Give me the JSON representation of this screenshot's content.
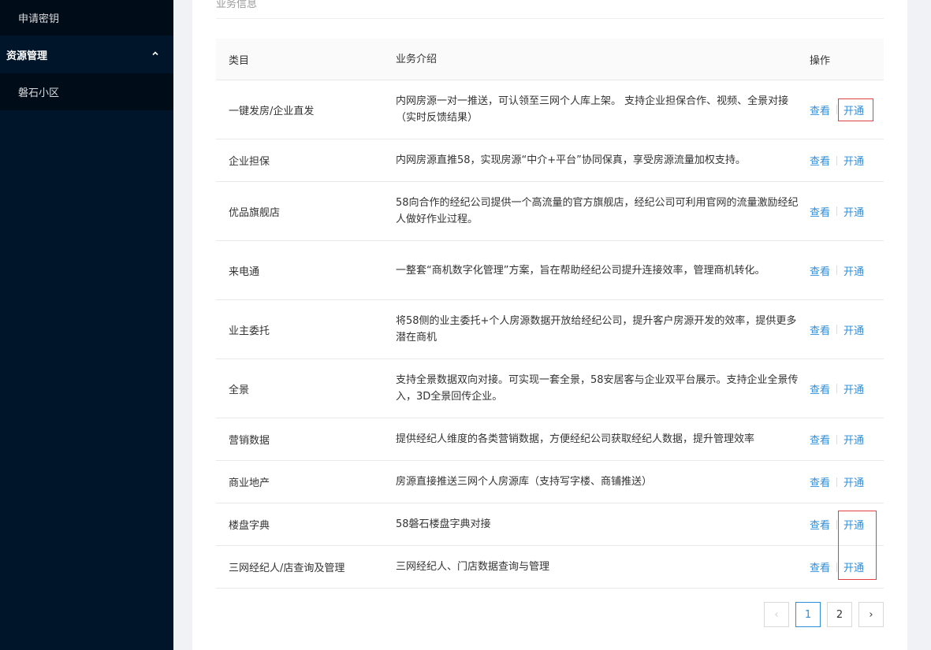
{
  "sidebar": {
    "top_item": "申请密钥",
    "group": "资源管理",
    "sub_item": "磐石小区"
  },
  "section": {
    "title": "业务信息"
  },
  "table": {
    "headers": [
      "类目",
      "业务介绍",
      "操作"
    ],
    "rows": [
      {
        "name": "一键发房/企业直发",
        "desc": "内网房源一对一推送，可认领至三网个人库上架。 支持企业担保合作、视频、全景对接（实时反馈结果）",
        "view": "查看",
        "open": "开通"
      },
      {
        "name": "企业担保",
        "desc": "内网房源直推58，实现房源“中介+平台”协同保真，享受房源流量加权支持。",
        "view": "查看",
        "open": "开通"
      },
      {
        "name": "优品旗舰店",
        "desc": "58向合作的经纪公司提供一个高流量的官方旗舰店，经纪公司可利用官网的流量激励经纪人做好作业过程。",
        "view": "查看",
        "open": "开通"
      },
      {
        "name": "来电通",
        "desc": "一整套“商机数字化管理”方案，旨在帮助经纪公司提升连接效率，管理商机转化。",
        "view": "查看",
        "open": "开通"
      },
      {
        "name": "业主委托",
        "desc": "将58侧的业主委托+个人房源数据开放给经纪公司，提升客户房源开发的效率，提供更多潜在商机",
        "view": "查看",
        "open": "开通"
      },
      {
        "name": "全景",
        "desc": "支持全景数据双向对接。可实现一套全景，58安居客与企业双平台展示。支持企业全景传入，3D全景回传企业。",
        "view": "查看",
        "open": "开通"
      },
      {
        "name": "营销数据",
        "desc": "提供经纪人维度的各类营销数据，方便经纪公司获取经纪人数据，提升管理效率",
        "view": "查看",
        "open": "开通"
      },
      {
        "name": "商业地产",
        "desc": "房源直接推送三网个人房源库（支持写字楼、商铺推送）",
        "view": "查看",
        "open": "开通"
      },
      {
        "name": "楼盘字典",
        "desc": "58磐石楼盘字典对接",
        "view": "查看",
        "open": "开通"
      },
      {
        "name": "三网经纪人/店查询及管理",
        "desc": "三网经纪人、门店数据查询与管理",
        "view": "查看",
        "open": "开通"
      }
    ]
  },
  "pagination": {
    "prev": "‹",
    "pages": [
      "1",
      "2"
    ],
    "current": "1",
    "next": "›"
  },
  "colors": {
    "sidebar_bg": "#001529",
    "link": "#2f8ed8",
    "highlight": "#e04040"
  }
}
